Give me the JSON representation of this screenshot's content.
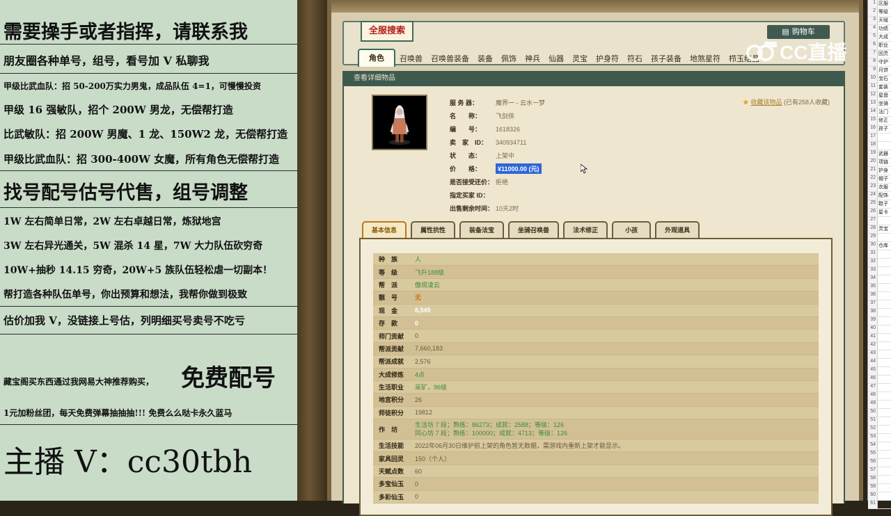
{
  "left_panel": {
    "lines": [
      {
        "text": "需要操手或者指挥，请联系我",
        "size": 27
      },
      {
        "text": "朋友圈各种单号，组号，看号加 V 私聊我",
        "size": 16
      },
      {
        "text": "甲级比武血队：招 50-200万实力男鬼，成品队伍 4=1，可慢慢投资",
        "size": 12
      },
      {
        "text": "甲级 16 强敏队，招个 200W 男龙，无偿帮打造",
        "size": 15
      },
      {
        "text": "比武敏队：招 200W 男魔、1 龙、150W2 龙，无偿帮打造",
        "size": 15
      },
      {
        "text": "甲级比武血队：招 300-400W 女魔，所有角色无偿帮打造",
        "size": 15
      },
      {
        "text": "找号配号估号代售，组号调整",
        "size": 27
      },
      {
        "text": "1W 左右简单日常，2W 左右卓越日常，炼狱地宫",
        "size": 14
      },
      {
        "text": "3W 左右异光通关，5W 混杀 14 星，7W 大力队伍砍穷奇",
        "size": 14
      },
      {
        "text": "10W+抽秒 14.15 穷奇，20W+5 族队伍轻松虐一切副本！",
        "size": 14
      },
      {
        "text": "帮打造各种队伍单号，你出预算和想法，我帮你做到极致",
        "size": 14
      },
      {
        "text": "估价加我 V，没链接上号估，列明细买号卖号不吃亏",
        "size": 15
      },
      {
        "text": "藏宝阁买东西通过我网易大神推荐购买，",
        "size": 12
      },
      {
        "text": "免费配号",
        "size": 34
      },
      {
        "text": "1元加粉丝团，每天免费弹幕抽抽抽!!! 免费么么哒卡永久蓝马",
        "size": 12
      },
      {
        "text": "主播 V：cc30tbh",
        "size": 44
      }
    ]
  },
  "header": {
    "logo": "全服搜索",
    "cart": "购物车",
    "tabs": [
      "角色",
      "召唤兽",
      "召唤兽装备",
      "装备",
      "佩饰",
      "神兵",
      "仙器",
      "灵宝",
      "护身符",
      "符石",
      "孩子装备",
      "地煞星符",
      "栉玉结晶"
    ]
  },
  "detail_bar": "查看详细物品",
  "favorite": {
    "link": "收藏该物品",
    "count": "(已有258人收藏)"
  },
  "info": [
    {
      "k": "服 务 器：",
      "v": "魔界一 - 云水一梦"
    },
    {
      "k": "名　　称：",
      "v": "飞剑侠"
    },
    {
      "k": "编　　号：",
      "v": "1618326"
    },
    {
      "k": "卖　家　ID：",
      "v": "340934711"
    },
    {
      "k": "状　　态：",
      "v": "上架中"
    },
    {
      "k": "价　　格：",
      "v": "¥11000.00 (元)"
    },
    {
      "k": "是否接受还价：",
      "v": "拒绝"
    },
    {
      "k": "指定买家 ID：",
      "v": ""
    },
    {
      "k": "出售剩余时间：",
      "v": "10天2时"
    }
  ],
  "subtabs": [
    "基本信息",
    "属性抗性",
    "装备法宝",
    "坐骑召唤兽",
    "法术修正",
    "小孩",
    "外观道具"
  ],
  "basic": [
    {
      "k": "种　族",
      "v": "人",
      "c": "grn"
    },
    {
      "k": "等　级",
      "v": "飞升188级",
      "c": "grn"
    },
    {
      "k": "帮　派",
      "v": "傲视凌云",
      "c": "grn"
    },
    {
      "k": "靓　号",
      "v": "无",
      "c": "org"
    },
    {
      "k": "现　金",
      "v": "8,549",
      "c": ""
    },
    {
      "k": "存　款",
      "v": "0",
      "c": ""
    },
    {
      "k": "师门贡献",
      "v": "0",
      "c": "dk"
    },
    {
      "k": "帮派贡献",
      "v": "7,660,183",
      "c": "dk"
    },
    {
      "k": "帮派成就",
      "v": "2,576",
      "c": "dk"
    },
    {
      "k": "大成修炼",
      "v": "4点",
      "c": "grn"
    },
    {
      "k": "生活职业",
      "v": "采矿，96级",
      "c": "grn"
    },
    {
      "k": "地宫积分",
      "v": "26",
      "c": "dk"
    },
    {
      "k": "师徒积分",
      "v": "19812",
      "c": "dk"
    },
    {
      "k": "作　坊",
      "v": "生活坊 7 段；熟练：86273；成就：2588；等级：126\n同心坊 7 段；熟练：100000；成就：4713；等级：126",
      "c": "grn ml"
    },
    {
      "k": "生活技能",
      "v": "2022年06月30日维护前上架的角色暂无数据，需游戏内重新上架才能显示。",
      "c": "dk"
    },
    {
      "k": "家具回灵",
      "v": "150（个人）",
      "c": "dk"
    },
    {
      "k": "天赋点数",
      "v": "60",
      "c": "dk"
    },
    {
      "k": "多宝仙玉",
      "v": "0",
      "c": "dk"
    },
    {
      "k": "多彩仙玉",
      "v": "0",
      "c": "dk"
    }
  ],
  "watermark": "CC直播",
  "sheet_rows": [
    "区服",
    "等级",
    "天赋",
    "功绩",
    "大成",
    "职业",
    "回灵",
    "守护",
    "月饼",
    "宝石",
    "套装",
    "星盘",
    "坐骑",
    "法门",
    "修正",
    "孩子",
    "",
    "",
    "武器",
    "项链",
    "护身",
    "帽子",
    "衣服",
    "配饰",
    "鞋子",
    "星卡",
    "",
    "灵宝",
    "",
    "仓库",
    "",
    "",
    "",
    "",
    "",
    "",
    "",
    "",
    "",
    "",
    "",
    "",
    "",
    "",
    "",
    "",
    "",
    "",
    "",
    "",
    "",
    "",
    "",
    "",
    "",
    "",
    "",
    "",
    "",
    "",
    ""
  ]
}
